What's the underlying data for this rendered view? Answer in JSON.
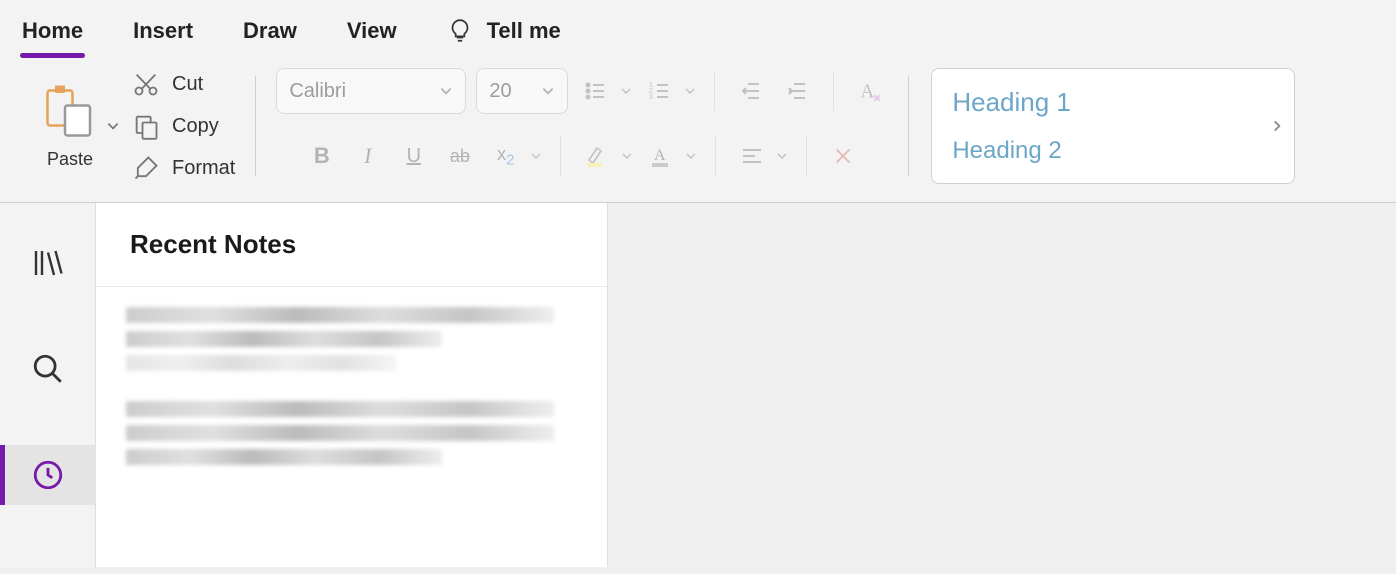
{
  "tabs": {
    "home": "Home",
    "insert": "Insert",
    "draw": "Draw",
    "view": "View",
    "tellme": "Tell me"
  },
  "clipboard": {
    "paste": "Paste",
    "cut": "Cut",
    "copy": "Copy",
    "format": "Format"
  },
  "font": {
    "name": "Calibri",
    "size": "20"
  },
  "styles": {
    "h1": "Heading 1",
    "h2": "Heading 2"
  },
  "panel": {
    "title": "Recent Notes"
  }
}
